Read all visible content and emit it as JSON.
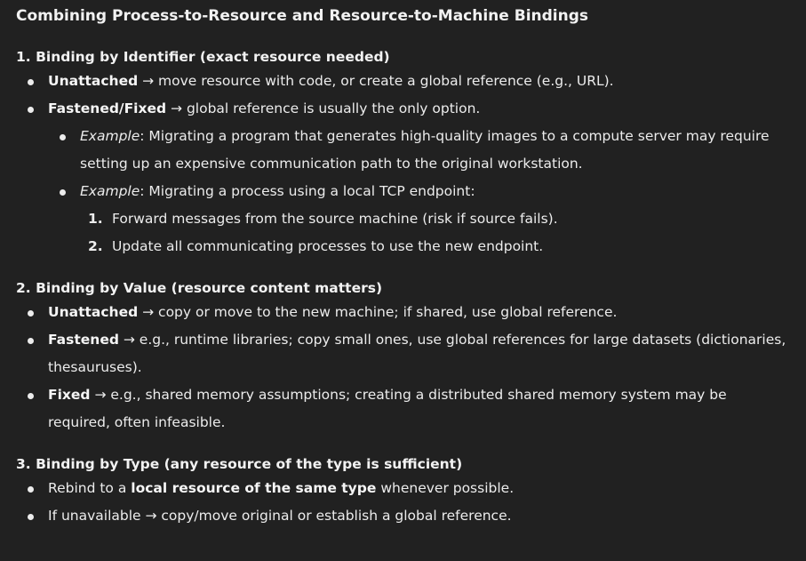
{
  "title": "Combining Process-to-Resource and Resource-to-Machine Bindings",
  "sections": [
    {
      "heading": "1. Binding by Identifier (exact resource needed)",
      "items": [
        {
          "bold": "Unattached",
          "text": " → move resource with code, or create a global reference (e.g., URL)."
        },
        {
          "bold": "Fastened/Fixed",
          "text": " → global reference is usually the only option."
        }
      ],
      "examples": [
        {
          "label": "Example",
          "text": ": Migrating a program that generates high-quality images to a compute server may require setting up an expensive communication path to the original workstation."
        },
        {
          "label": "Example",
          "text": ": Migrating a process using a local TCP endpoint:"
        }
      ],
      "steps": [
        {
          "num": "1.",
          "text": "Forward messages from the source machine (risk if source fails)."
        },
        {
          "num": "2.",
          "text": "Update all communicating processes to use the new endpoint."
        }
      ]
    },
    {
      "heading": "2. Binding by Value (resource content matters)",
      "items": [
        {
          "bold": "Unattached",
          "text": " → copy or move to the new machine; if shared, use global reference."
        },
        {
          "bold": "Fastened",
          "text": " → e.g., runtime libraries; copy small ones, use global references for large datasets (dictionaries, thesauruses)."
        },
        {
          "bold": "Fixed",
          "text": " → e.g., shared memory assumptions; creating a distributed shared memory system may be required, often infeasible."
        }
      ]
    },
    {
      "heading": "3. Binding by Type (any resource of the type is sufficient)",
      "items": [
        {
          "pre": "Rebind to a ",
          "bold": "local resource of the same type",
          "post": " whenever possible."
        },
        {
          "text": "If unavailable → copy/move original or establish a global reference."
        }
      ]
    }
  ]
}
